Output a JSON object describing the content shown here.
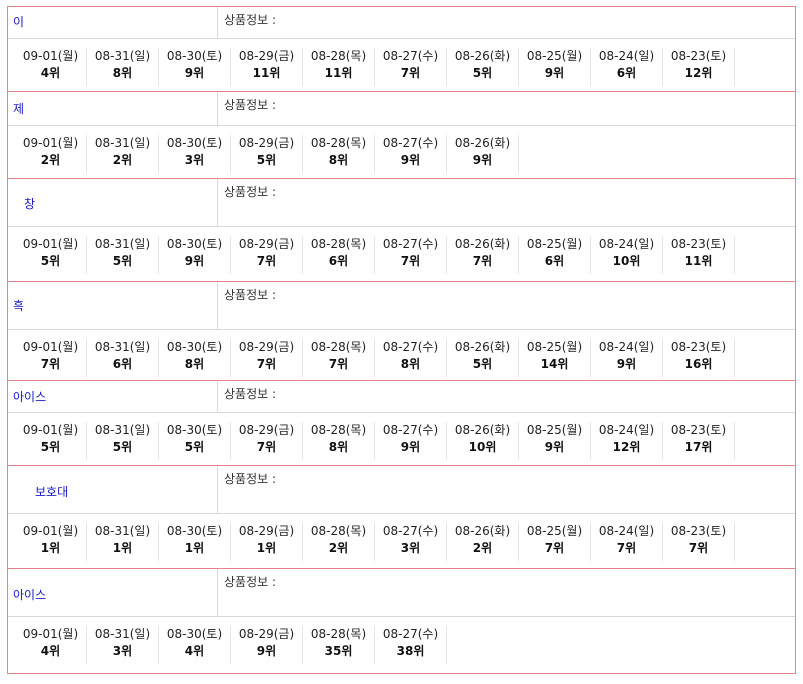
{
  "info_label": "상품정보 :",
  "products": [
    {
      "name": "이",
      "ranks": [
        {
          "date": "09-01(월)",
          "rank": "4위"
        },
        {
          "date": "08-31(일)",
          "rank": "8위"
        },
        {
          "date": "08-30(토)",
          "rank": "9위"
        },
        {
          "date": "08-29(금)",
          "rank": "11위"
        },
        {
          "date": "08-28(목)",
          "rank": "11위"
        },
        {
          "date": "08-27(수)",
          "rank": "7위"
        },
        {
          "date": "08-26(화)",
          "rank": "5위"
        },
        {
          "date": "08-25(월)",
          "rank": "9위"
        },
        {
          "date": "08-24(일)",
          "rank": "6위"
        },
        {
          "date": "08-23(토)",
          "rank": "12위"
        }
      ]
    },
    {
      "name": "제",
      "ranks": [
        {
          "date": "09-01(월)",
          "rank": "2위"
        },
        {
          "date": "08-31(일)",
          "rank": "2위"
        },
        {
          "date": "08-30(토)",
          "rank": "3위"
        },
        {
          "date": "08-29(금)",
          "rank": "5위"
        },
        {
          "date": "08-28(목)",
          "rank": "8위"
        },
        {
          "date": "08-27(수)",
          "rank": "9위"
        },
        {
          "date": "08-26(화)",
          "rank": "9위"
        }
      ]
    },
    {
      "name": "창",
      "ranks": [
        {
          "date": "09-01(월)",
          "rank": "5위"
        },
        {
          "date": "08-31(일)",
          "rank": "5위"
        },
        {
          "date": "08-30(토)",
          "rank": "9위"
        },
        {
          "date": "08-29(금)",
          "rank": "7위"
        },
        {
          "date": "08-28(목)",
          "rank": "6위"
        },
        {
          "date": "08-27(수)",
          "rank": "7위"
        },
        {
          "date": "08-26(화)",
          "rank": "7위"
        },
        {
          "date": "08-25(월)",
          "rank": "6위"
        },
        {
          "date": "08-24(일)",
          "rank": "10위"
        },
        {
          "date": "08-23(토)",
          "rank": "11위"
        }
      ]
    },
    {
      "name": "흑",
      "ranks": [
        {
          "date": "09-01(월)",
          "rank": "7위"
        },
        {
          "date": "08-31(일)",
          "rank": "6위"
        },
        {
          "date": "08-30(토)",
          "rank": "8위"
        },
        {
          "date": "08-29(금)",
          "rank": "7위"
        },
        {
          "date": "08-28(목)",
          "rank": "7위"
        },
        {
          "date": "08-27(수)",
          "rank": "8위"
        },
        {
          "date": "08-26(화)",
          "rank": "5위"
        },
        {
          "date": "08-25(월)",
          "rank": "14위"
        },
        {
          "date": "08-24(일)",
          "rank": "9위"
        },
        {
          "date": "08-23(토)",
          "rank": "16위"
        }
      ]
    },
    {
      "name": "아이스",
      "ranks": [
        {
          "date": "09-01(월)",
          "rank": "5위"
        },
        {
          "date": "08-31(일)",
          "rank": "5위"
        },
        {
          "date": "08-30(토)",
          "rank": "5위"
        },
        {
          "date": "08-29(금)",
          "rank": "7위"
        },
        {
          "date": "08-28(목)",
          "rank": "8위"
        },
        {
          "date": "08-27(수)",
          "rank": "9위"
        },
        {
          "date": "08-26(화)",
          "rank": "10위"
        },
        {
          "date": "08-25(월)",
          "rank": "9위"
        },
        {
          "date": "08-24(일)",
          "rank": "12위"
        },
        {
          "date": "08-23(토)",
          "rank": "17위"
        }
      ]
    },
    {
      "name": "보호대",
      "ranks": [
        {
          "date": "09-01(월)",
          "rank": "1위"
        },
        {
          "date": "08-31(일)",
          "rank": "1위"
        },
        {
          "date": "08-30(토)",
          "rank": "1위"
        },
        {
          "date": "08-29(금)",
          "rank": "1위"
        },
        {
          "date": "08-28(목)",
          "rank": "2위"
        },
        {
          "date": "08-27(수)",
          "rank": "3위"
        },
        {
          "date": "08-26(화)",
          "rank": "2위"
        },
        {
          "date": "08-25(월)",
          "rank": "7위"
        },
        {
          "date": "08-24(일)",
          "rank": "7위"
        },
        {
          "date": "08-23(토)",
          "rank": "7위"
        }
      ]
    },
    {
      "name": "아이스",
      "ranks": [
        {
          "date": "09-01(월)",
          "rank": "4위"
        },
        {
          "date": "08-31(일)",
          "rank": "3위"
        },
        {
          "date": "08-30(토)",
          "rank": "4위"
        },
        {
          "date": "08-29(금)",
          "rank": "9위"
        },
        {
          "date": "08-28(목)",
          "rank": "35위"
        },
        {
          "date": "08-27(수)",
          "rank": "38위"
        }
      ]
    }
  ]
}
